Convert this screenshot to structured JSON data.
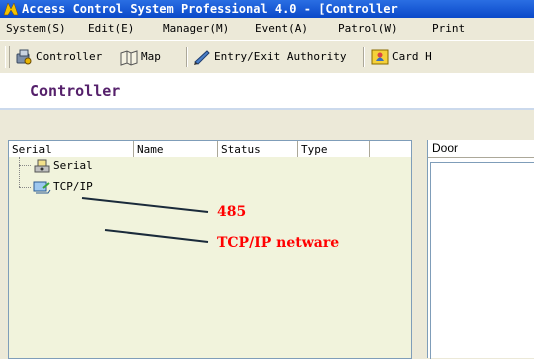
{
  "window": {
    "title": "Access Control System Professional 4.0 - [Controller"
  },
  "menubar": {
    "items": [
      {
        "label": "System(S)"
      },
      {
        "label": "Edit(E)"
      },
      {
        "label": "Manager(M)"
      },
      {
        "label": "Event(A)"
      },
      {
        "label": "Patrol(W)"
      },
      {
        "label": "Print"
      }
    ]
  },
  "toolbar": {
    "controller_label": "Controller",
    "map_label": "Map",
    "authority_label": "Entry/Exit Authority",
    "card_label": "Card H"
  },
  "page": {
    "title": "Controller"
  },
  "table": {
    "columns": [
      "Serial",
      "Name",
      "Status",
      "Type"
    ]
  },
  "tree": {
    "items": [
      {
        "label": "Serial"
      },
      {
        "label": "TCP/IP"
      }
    ]
  },
  "right_panel": {
    "header": "Door"
  },
  "annotations": {
    "serial_note": "485",
    "tcpip_note": "TCP/IP netware",
    "color": "#ff0000"
  }
}
